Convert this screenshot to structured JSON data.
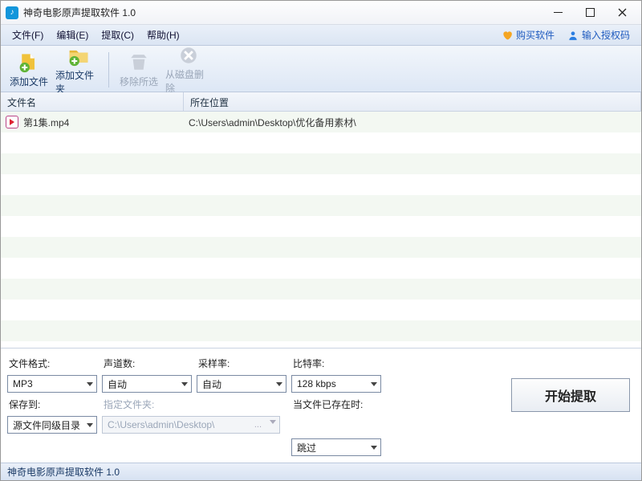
{
  "title": "神奇电影原声提取软件 1.0",
  "menu": {
    "file": "文件(F)",
    "edit": "编辑(E)",
    "extract": "提取(C)",
    "help": "帮助(H)",
    "buy": "购买软件",
    "license": "输入授权码"
  },
  "toolbar": {
    "add_file": "添加文件",
    "add_folder": "添加文件夹",
    "remove_sel": "移除所选",
    "remove_disk": "从磁盘删除"
  },
  "columns": {
    "name": "文件名",
    "location": "所在位置"
  },
  "rows": [
    {
      "name": "第1集.mp4",
      "location": "C:\\Users\\admin\\Desktop\\优化备用素材\\"
    }
  ],
  "settings": {
    "format_label": "文件格式:",
    "format_value": "MP3",
    "channels_label": "声道数:",
    "channels_value": "自动",
    "samplerate_label": "采样率:",
    "samplerate_value": "自动",
    "bitrate_label": "比特率:",
    "bitrate_value": "128 kbps",
    "saveto_label": "保存到:",
    "saveto_value": "源文件同级目录",
    "folder_label": "指定文件夹:",
    "folder_value": "C:\\Users\\admin\\Desktop\\",
    "exists_label": "当文件已存在时:",
    "exists_value": "跳过",
    "start": "开始提取"
  },
  "status": "神奇电影原声提取软件 1.0"
}
